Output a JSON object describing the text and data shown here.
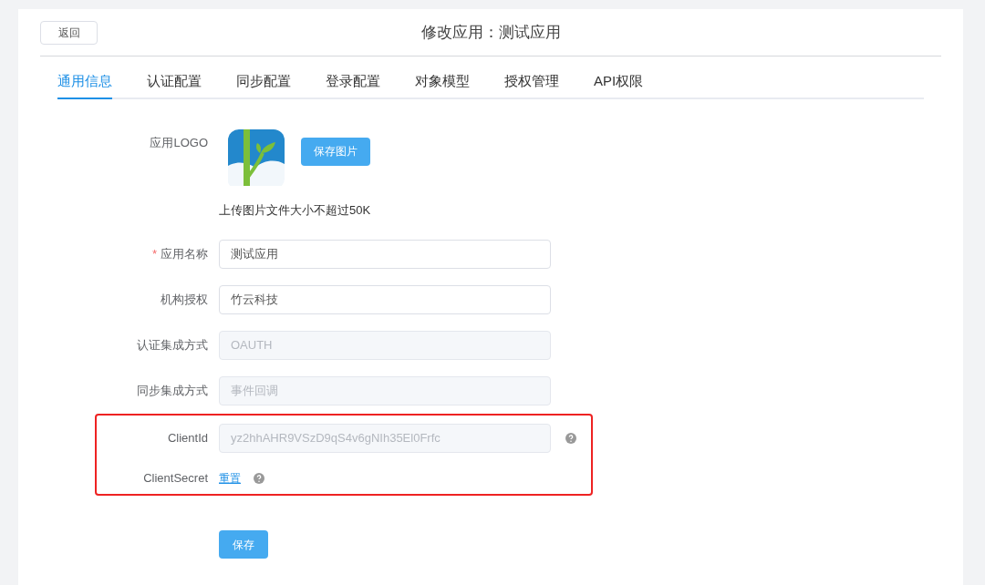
{
  "header": {
    "back_button": "返回",
    "title": "修改应用：测试应用"
  },
  "tabs": [
    {
      "label": "通用信息",
      "selected": true
    },
    {
      "label": "认证配置",
      "selected": false
    },
    {
      "label": "同步配置",
      "selected": false
    },
    {
      "label": "登录配置",
      "selected": false
    },
    {
      "label": "对象模型",
      "selected": false
    },
    {
      "label": "授权管理",
      "selected": false
    },
    {
      "label": "API权限",
      "selected": false
    }
  ],
  "logo": {
    "label": "应用LOGO",
    "button": "保存图片",
    "hint": "上传图片文件大小不超过50K"
  },
  "fields": [
    {
      "label": "应用名称",
      "value": "测试应用",
      "required": true,
      "disabled": false
    },
    {
      "label": "机构授权",
      "value": "竹云科技",
      "required": false,
      "disabled": false
    },
    {
      "label": "认证集成方式",
      "value": "OAUTH",
      "required": false,
      "disabled": true
    },
    {
      "label": "同步集成方式",
      "value": "事件回调",
      "required": false,
      "disabled": true
    }
  ],
  "highlighted": [
    {
      "kind": "field",
      "label": "ClientId",
      "value": "yz2hhAHR9VSzD9qS4v6gNIh35El0Frfc",
      "disabled": true,
      "help": true
    },
    {
      "kind": "link",
      "label": "ClientSecret",
      "link": "重置",
      "help": true
    }
  ],
  "save_button": "保存",
  "required_mark": "*"
}
